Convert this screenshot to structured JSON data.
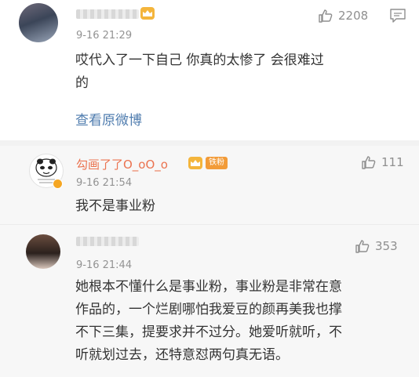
{
  "comments": [
    {
      "time": "9-16 21:29",
      "likes": "2208",
      "text_lines": [
        "哎代入了一下自己 你真的太惨了 会很难过",
        "的"
      ],
      "view_original": "查看原微博"
    },
    {
      "name": "勾画了了O_oO_o",
      "fan_badge": "铁粉",
      "time": "9-16 21:54",
      "likes": "111",
      "text_lines": [
        "我不是事业粉"
      ]
    },
    {
      "time": "9-16 21:44",
      "likes": "353",
      "text_lines": [
        "她根本不懂什么是事业粉，事业粉是非常在意",
        "作品的，一个烂剧哪怕我爱豆的颜再美我也撑",
        "不下三集，提要求并不过分。她爱听就听，不",
        "听就划过去，还特意怼两句真无语。"
      ]
    }
  ],
  "colors": {
    "username": "#eb7350",
    "link": "#507daf",
    "meta": "#939393",
    "crown_badge": "#f4b53c",
    "fan_badge": "#f29b38"
  },
  "icons": [
    "thumbs-up-icon",
    "comment-icon",
    "crown-badge-icon",
    "verified-icon"
  ]
}
